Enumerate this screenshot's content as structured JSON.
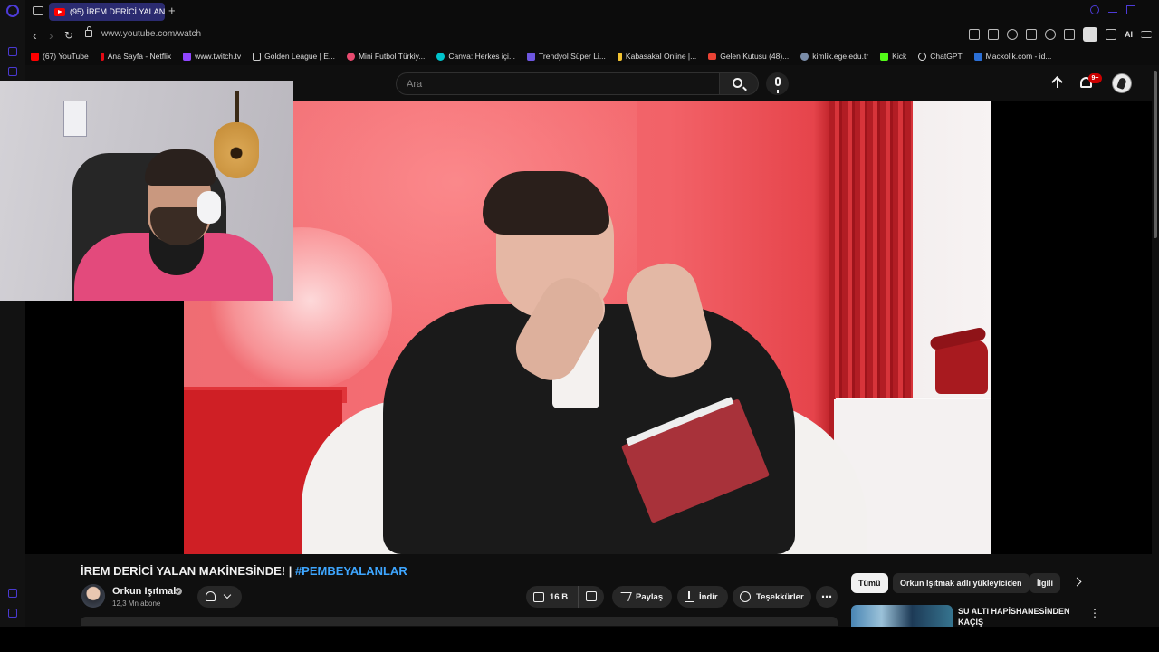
{
  "browser": {
    "tab_title": "(95) İREM DERİCİ YALAN ...",
    "new_tab": "+",
    "url": "www.youtube.com/watch",
    "toolbar_ai": "AI",
    "bookmarks": [
      {
        "label": "(67) YouTube",
        "color": "#ff0000"
      },
      {
        "label": "Ana Sayfa - Netflix",
        "color": "#e50914"
      },
      {
        "label": "www.twitch.tv",
        "color": "#9146ff"
      },
      {
        "label": "Golden League | E...",
        "color": "#cccccc"
      },
      {
        "label": "Mini Futbol Türkiy...",
        "color": "#e84a6f"
      },
      {
        "label": "Canva: Herkes içi...",
        "color": "#00c4cc"
      },
      {
        "label": "Trendyol Süper Li...",
        "color": "#6e57e0"
      },
      {
        "label": "Kabasakal Online |...",
        "color": "#f2c230"
      },
      {
        "label": "Gelen Kutusu (48)...",
        "color": "#ea4335"
      },
      {
        "label": "kimlik.ege.edu.tr",
        "color": "#7a8ca8"
      },
      {
        "label": "Kick",
        "color": "#53fc18"
      },
      {
        "label": "ChatGPT",
        "color": "#dddddd"
      },
      {
        "label": "Mackolik.com - id...",
        "color": "#2b6fd6"
      }
    ]
  },
  "youtube": {
    "search_placeholder": "Ara",
    "notification_count": "9+",
    "video": {
      "title_main": "İREM DERİCİ YALAN MAKİNESİNDE! | ",
      "title_hashtag": "#PEMBEYALANLAR"
    },
    "channel": {
      "name": "Orkun Işıtmak",
      "subscribers": "12,3 Mn abone"
    },
    "actions": {
      "likes": "16 B",
      "share": "Paylaş",
      "download": "İndir",
      "thanks": "Teşekkürler",
      "more": "⋯"
    },
    "chips": {
      "all": "Tümü",
      "uploader": "Orkun Işıtmak adlı yükleyiciden",
      "related": "İlgili"
    },
    "recommendation": {
      "title": "SU ALTI HAPİSHANESİNDEN KAÇIŞ",
      "more": "⋮"
    }
  },
  "colors": {
    "accent": "#3ea6ff",
    "badge": "#cc0000",
    "tab_active": "#2b2b70"
  }
}
